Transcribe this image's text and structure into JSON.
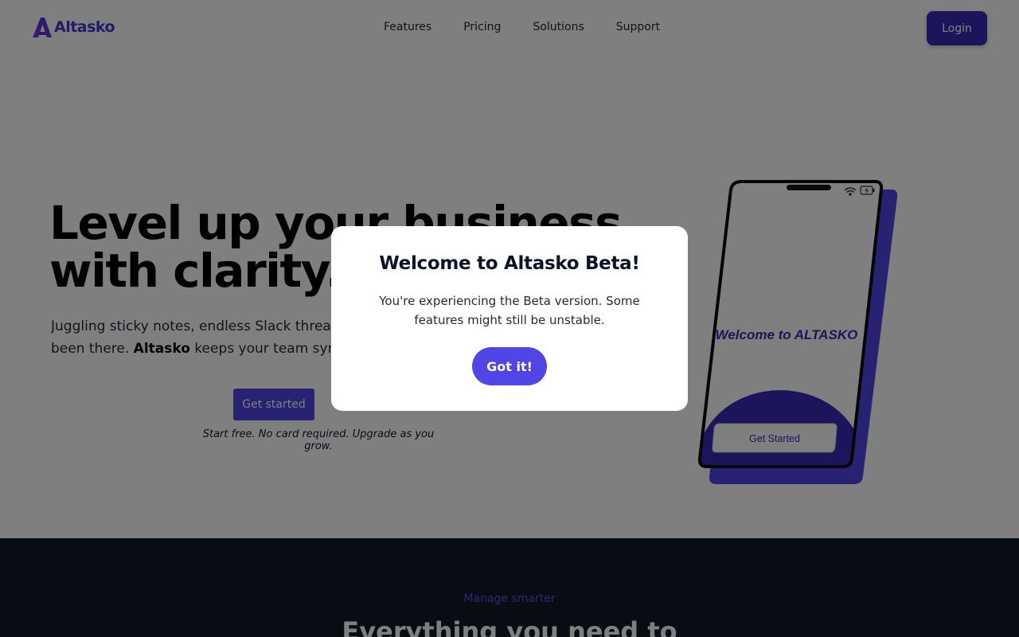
{
  "brand": {
    "name": "Altasko",
    "accent": "#4f46e5",
    "logo_color": "#4338ca"
  },
  "nav": {
    "items": [
      {
        "label": "Features"
      },
      {
        "label": "Pricing"
      },
      {
        "label": "Solutions"
      },
      {
        "label": "Support"
      }
    ],
    "login_label": "Login"
  },
  "hero": {
    "title_line1": "Level up your business",
    "title_line2": "with clarity.",
    "desc_line1": "Juggling sticky notes, endless Slack threads",
    "desc_line2_pre": "been there.",
    "desc_line2_brand": "Altasko",
    "desc_line2_post": "keeps your team sync",
    "cta_label": "Get started",
    "cta_note": "Start free. No card required. Upgrade as you grow."
  },
  "phone": {
    "welcome_text": "Welcome to ALTASKO",
    "button_label": "Get Started",
    "icons": [
      "wifi-icon",
      "battery-charging-icon"
    ]
  },
  "section": {
    "eyebrow": "Manage smarter",
    "title": "Everything you need to"
  },
  "modal": {
    "title": "Welcome to Altasko Beta!",
    "body": "You're experiencing the Beta version. Some features might still be unstable.",
    "button_label": "Got it!"
  }
}
